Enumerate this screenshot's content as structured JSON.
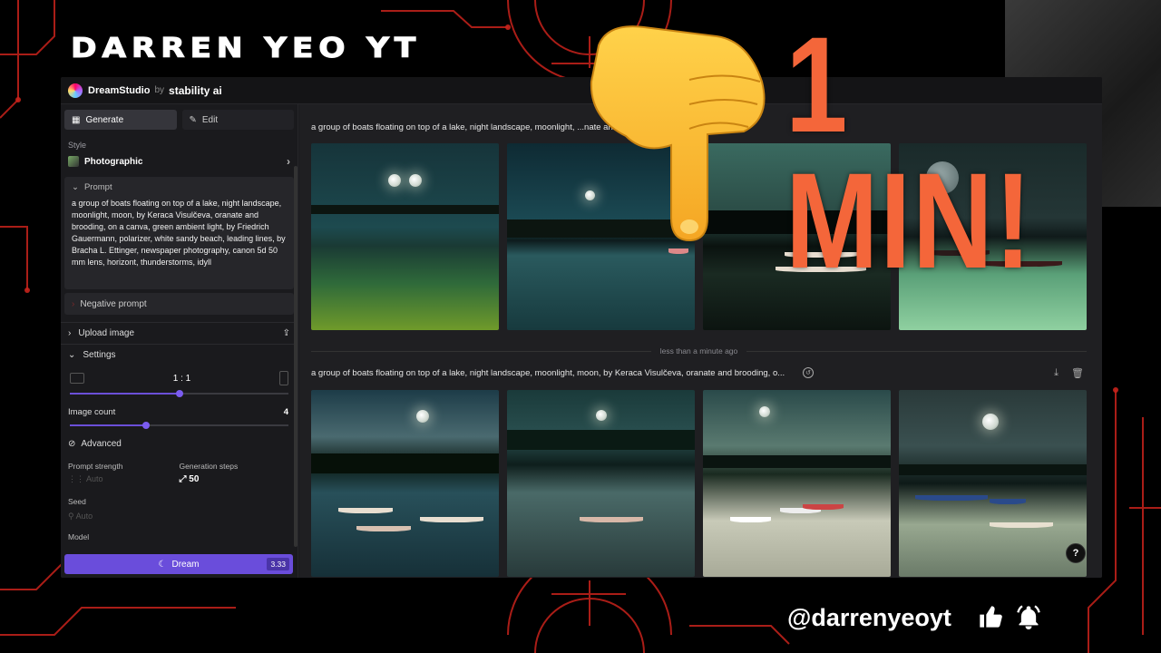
{
  "overlay": {
    "channel_title": "DARREN YEO YT",
    "banner": "1 MIN!",
    "handle": "@darrenyeoyt",
    "icons": [
      "thumbs-up-icon",
      "bell-icon"
    ]
  },
  "app": {
    "brand": "DreamStudio",
    "by": "by",
    "company": "stability ai"
  },
  "sidebar": {
    "tabs": [
      {
        "label": "Generate",
        "icon": "generate-icon"
      },
      {
        "label": "Edit",
        "icon": "edit-icon"
      }
    ],
    "style_label": "Style",
    "style_value": "Photographic",
    "prompt_label": "Prompt",
    "prompt_text": "a group of boats floating on top of a lake, night landscape, moonlight, moon, by Keraca Visulčeva, oranate and brooding, on a canva, green ambient light, by Friedrich Gauermann, polarizer, white sandy beach, leading lines, by Bracha L. Ettinger, newspaper photography, canon 5d 50 mm lens, horizont, thunderstorms, idyll",
    "negative_prompt_label": "Negative prompt",
    "upload_label": "Upload image",
    "settings_label": "Settings",
    "aspect_ratio": "1 : 1",
    "aspect_ratio_slider": 0.5,
    "image_count_label": "Image count",
    "image_count": "4",
    "image_count_slider": 0.35,
    "advanced_label": "Advanced",
    "prompt_strength_label": "Prompt strength",
    "prompt_strength_value": "Auto",
    "generation_steps_label": "Generation steps",
    "generation_steps_value": "50",
    "seed_label": "Seed",
    "seed_value": "Auto",
    "model_label": "Model",
    "dream_label": "Dream",
    "dream_cost": "3.33"
  },
  "main": {
    "batches": [
      {
        "prompt": "a group of boats floating on top of a lake, night landscape, moonlight, ...nate and brooding, o...",
        "images": 4
      },
      {
        "prompt": "a group of boats floating on top of a lake, night landscape, moonlight, moon, by Keraca Visulčeva, oranate and brooding, o...",
        "images": 4
      }
    ],
    "time_separator": "less than a minute ago",
    "help": "?"
  },
  "colors": {
    "accent": "#6a4ddb",
    "banner": "#f4663a",
    "frame_red": "#c8231c"
  }
}
